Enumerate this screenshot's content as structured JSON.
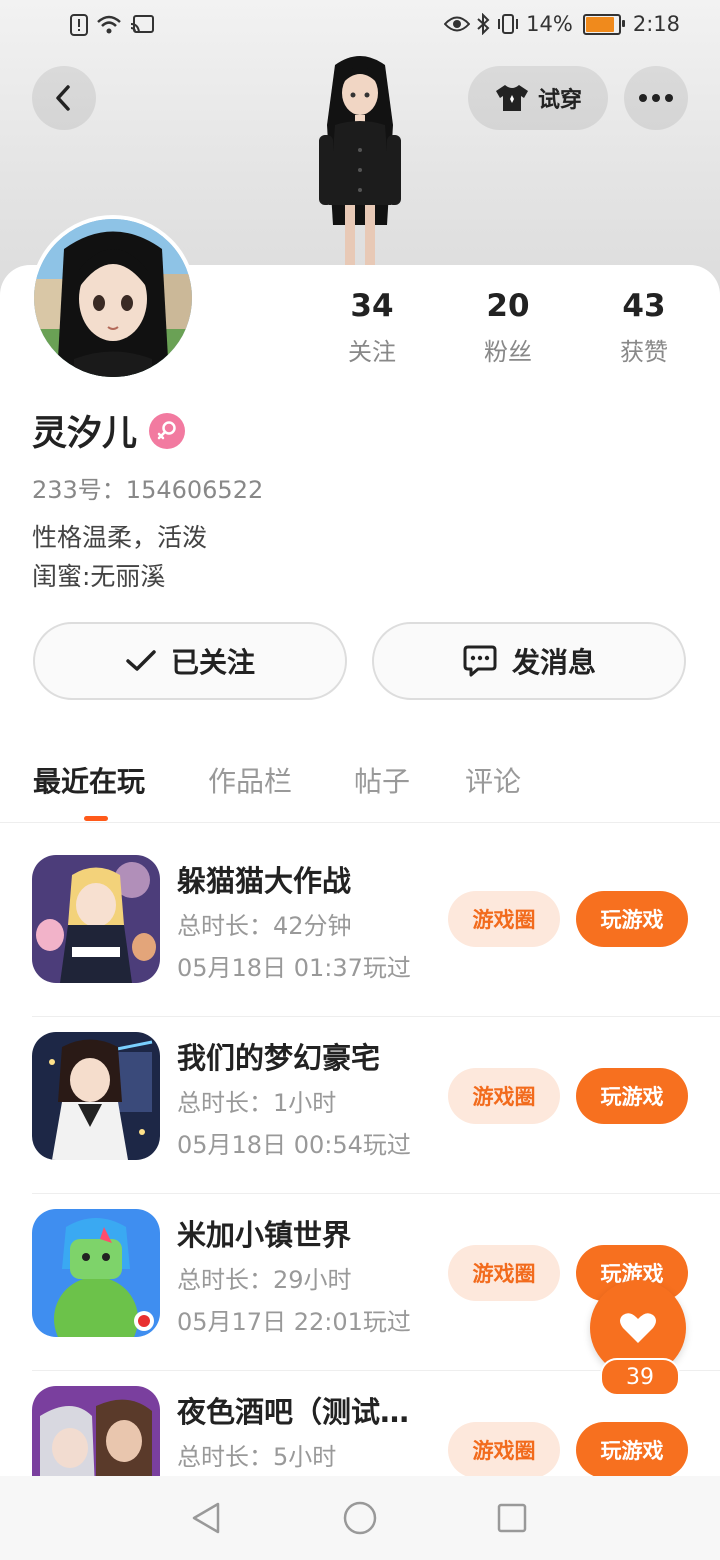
{
  "status_bar": {
    "battery_percent": "14%",
    "time": "2:18",
    "icons": [
      "alert-icon",
      "wifi-icon",
      "cast-icon",
      "eye-icon",
      "bluetooth-icon",
      "vibrate-icon",
      "battery-icon"
    ]
  },
  "header": {
    "try_on_label": "试穿"
  },
  "profile": {
    "stats": [
      {
        "value": "34",
        "label": "关注"
      },
      {
        "value": "20",
        "label": "粉丝"
      },
      {
        "value": "43",
        "label": "获赞"
      }
    ],
    "name": "灵汐儿",
    "gender": "female",
    "uid": "233号：154606522",
    "bio_lines": [
      "性格温柔，活泼",
      "闺蜜:无丽溪"
    ]
  },
  "actions": {
    "follow_label": "已关注",
    "message_label": "发消息"
  },
  "tabs": [
    {
      "label": "最近在玩",
      "active": true
    },
    {
      "label": "作品栏",
      "active": false
    },
    {
      "label": "帖子",
      "active": false
    },
    {
      "label": "评论",
      "active": false
    }
  ],
  "games": [
    {
      "title": "躲猫猫大作战",
      "duration": "总时长：42分钟",
      "last_played": "05月18日 01:37玩过",
      "circle_label": "游戏圈",
      "play_label": "玩游戏"
    },
    {
      "title": "我们的梦幻豪宅",
      "duration": "总时长：1小时",
      "last_played": "05月18日 00:54玩过",
      "circle_label": "游戏圈",
      "play_label": "玩游戏"
    },
    {
      "title": "米加小镇世界",
      "duration": "总时长：29小时",
      "last_played": "05月17日 22:01玩过",
      "circle_label": "游戏圈",
      "play_label": "玩游戏"
    },
    {
      "title": "夜色酒吧（测试…",
      "duration": "总时长：5小时",
      "last_played": "",
      "circle_label": "游戏圈",
      "play_label": "玩游戏"
    }
  ],
  "like_fab": {
    "count": "39"
  },
  "colors": {
    "accent": "#f7701f",
    "accent_light": "#fde8dc",
    "gender_pink": "#f27aa0"
  }
}
